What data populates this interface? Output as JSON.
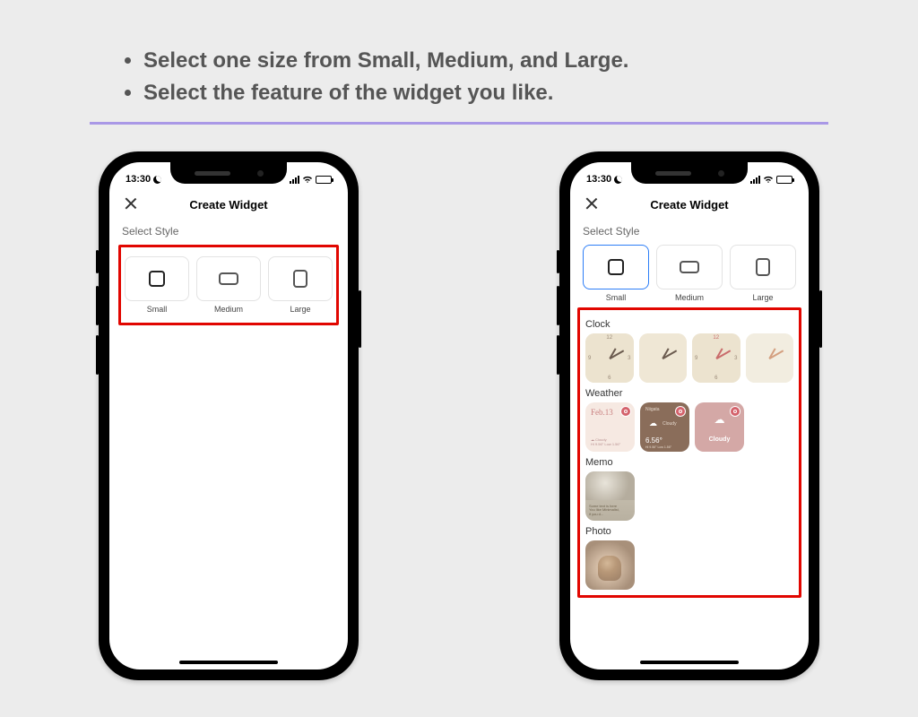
{
  "instructions": [
    "Select one size from Small, Medium, and Large.",
    "Select the feature of the widget you like."
  ],
  "statusbar": {
    "time": "13:30",
    "moon": true
  },
  "nav": {
    "title": "Create Widget"
  },
  "sections": {
    "selectStyle": "Select Style"
  },
  "sizes": {
    "small": "Small",
    "medium": "Medium",
    "large": "Large"
  },
  "categories": {
    "clock": "Clock",
    "weather": "Weather",
    "memo": "Memo",
    "photo": "Photo"
  },
  "weather": {
    "tile1_date": "Feb.13",
    "tile1_sub1": "☁ Cloudy",
    "tile1_sub2": "Hi 9.56° Low 1.56°",
    "tile2_loc": "Niigata",
    "tile2_cond": "Cloudy",
    "tile2_temp": "6.56°",
    "tile2_range": "Hi 9.56° Low 1.56°",
    "tile3_cond": "Cloudy"
  },
  "memo": {
    "line1": "Some text is here",
    "line2": "You like Minimalist,",
    "line3": "if you d..."
  }
}
